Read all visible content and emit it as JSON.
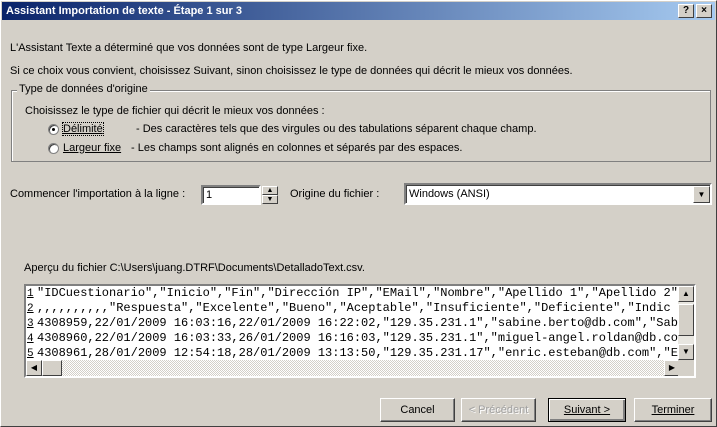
{
  "window": {
    "title": "Assistant Importation de texte - Étape 1 sur 3",
    "help_label": "?",
    "close_label": "×"
  },
  "intro": {
    "line1": "L'Assistant Texte a déterminé que vos données sont de type Largeur fixe.",
    "line2": "Si ce choix vous convient, choisissez Suivant, sinon choisissez le type de données qui décrit le mieux vos données."
  },
  "original_type": {
    "legend": "Type de données d'origine",
    "prompt": "Choisissez le type de fichier qui décrit le mieux vos données :",
    "options": [
      {
        "label": "Délimité",
        "description": "- Des caractères tels que des virgules ou des tabulations séparent chaque champ.",
        "selected": true
      },
      {
        "label": "Largeur fixe",
        "description": "- Les champs sont alignés en colonnes et séparés par des espaces.",
        "selected": false
      }
    ]
  },
  "import_start": {
    "label": "Commencer l'importation à la ligne :",
    "value": "1"
  },
  "file_origin": {
    "label": "Origine du fichier :",
    "value": "Windows (ANSI)"
  },
  "preview": {
    "title": "Aperçu du fichier C:\\Users\\juang.DTRF\\Documents\\DetalladoText.csv.",
    "rows": [
      {
        "num": "1",
        "text": "\"IDCuestionario\",\"Inicio\",\"Fin\",\"Dirección IP\",\"EMail\",\"Nombre\",\"Apellido 1\",\"Apellido 2\""
      },
      {
        "num": "2",
        "text": ",,,,,,,,,,\"Respuesta\",\"Excelente\",\"Bueno\",\"Aceptable\",\"Insuficiente\",\"Deficiente\",\"Indic"
      },
      {
        "num": "3",
        "text": "4308959,22/01/2009 16:03:16,22/01/2009 16:22:02,\"129.35.231.1\",\"sabine.berto@db.com\",\"Sab"
      },
      {
        "num": "4",
        "text": "4308960,22/01/2009 16:03:33,26/01/2009 16:16:03,\"129.35.231.1\",\"miguel-angel.roldan@db.co"
      },
      {
        "num": "5",
        "text": "4308961,28/01/2009 12:54:18,28/01/2009 13:13:50,\"129.35.231.17\",\"enric.esteban@db.com\",\"E"
      }
    ]
  },
  "buttons": {
    "cancel": "Cancel",
    "previous": "< Précédent",
    "next": "Suivant >",
    "finish": "Terminer"
  },
  "colors": {
    "titlebar_start": "#0a246a",
    "titlebar_end": "#a6caf0",
    "dialog_face": "#d4d0c8"
  }
}
